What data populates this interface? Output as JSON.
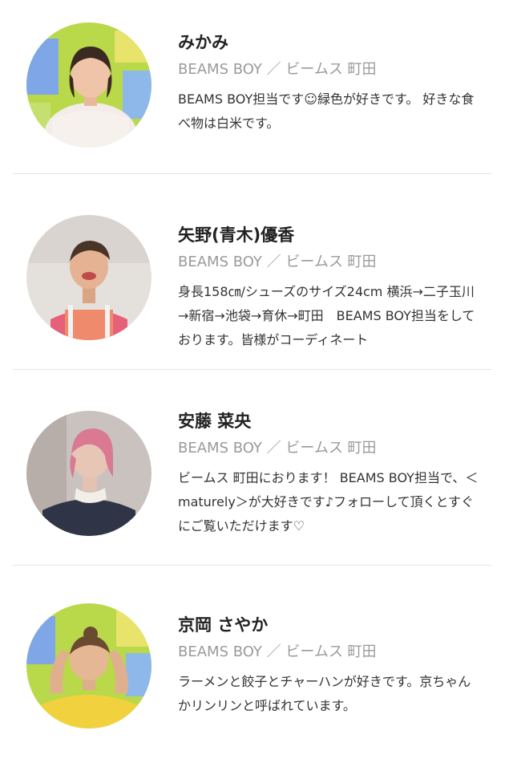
{
  "staff": [
    {
      "name": "みかみ",
      "shop": "BEAMS BOY ／ ビームス 町田",
      "bio": "BEAMS BOY担当です☺緑色が好きです。 好きな食べ物は白米です。"
    },
    {
      "name": "矢野(青木)優香",
      "shop": "BEAMS BOY ／ ビームス 町田",
      "bio": "身長158㎝/シューズのサイズ24cm 横浜→二子玉川→新宿→池袋→育休→町田　BEAMS BOY担当をしております。皆様がコーディネート"
    },
    {
      "name": "安藤 菜央",
      "shop": "BEAMS BOY ／ ビームス 町田",
      "bio": "ビームス 町田におります！ BEAMS BOY担当で、＜maturely＞が大好きです♪フォローして頂くとすぐにご覧いただけます♡"
    },
    {
      "name": "京岡 さやか",
      "shop": "BEAMS BOY ／ ビームス 町田",
      "bio": "ラーメンと餃子とチャーハンが好きです。京ちゃんかリンリンと呼ばれています。"
    }
  ]
}
